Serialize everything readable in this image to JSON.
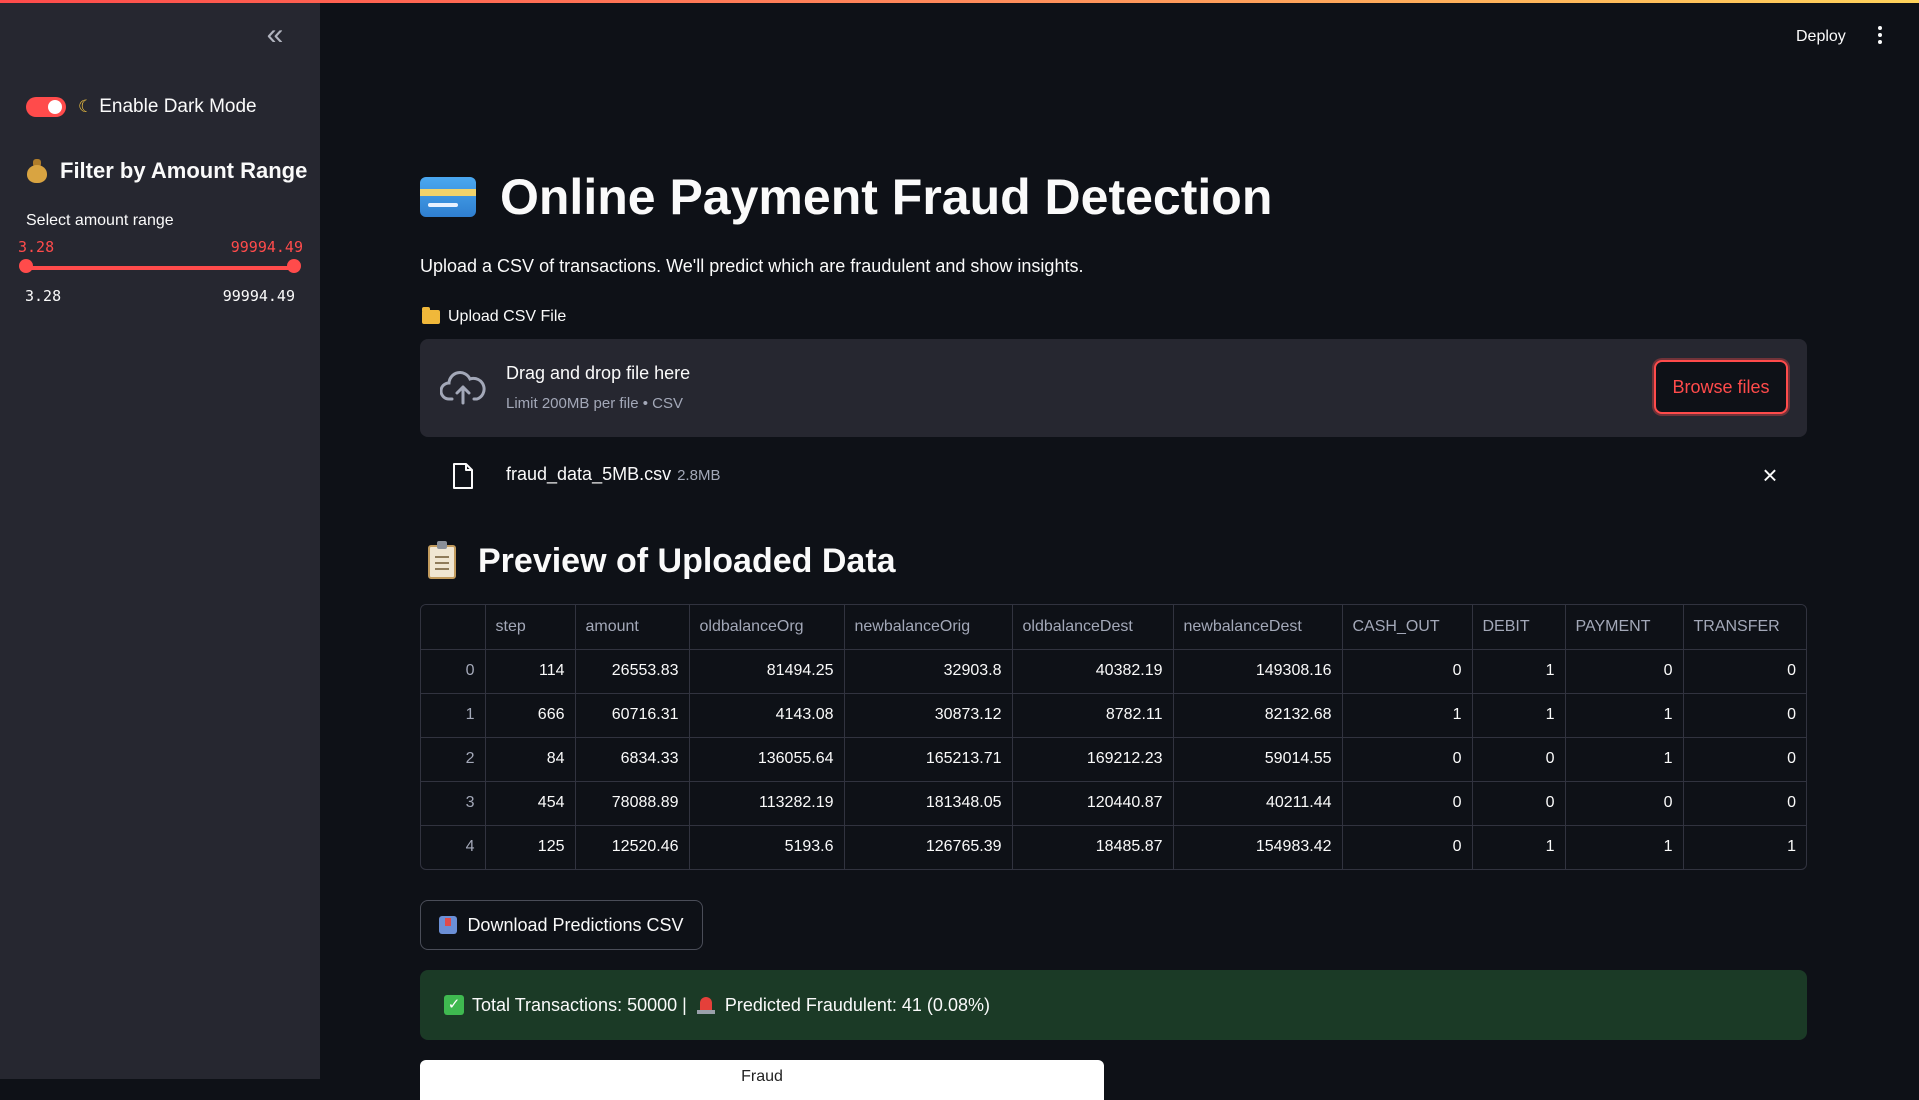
{
  "sidebar": {
    "collapse_glyph": "«",
    "dark_mode_label": "Enable Dark Mode",
    "filter_heading": "Filter by Amount Range",
    "range_label": "Select amount range",
    "range_min": "3.28",
    "range_max": "99994.49",
    "range_lo_value": "3.28",
    "range_hi_value": "99994.49"
  },
  "header": {
    "deploy_label": "Deploy"
  },
  "main": {
    "title": "Online Payment Fraud Detection",
    "subtitle": "Upload a CSV of transactions. We'll predict which are fraudulent and show insights.",
    "upload_label": "Upload CSV File",
    "dropzone_title": "Drag and drop file here",
    "dropzone_sub": "Limit 200MB per file • CSV",
    "browse_label": "Browse files",
    "file_name": "fraud_data_5MB.csv",
    "file_size": "2.8MB",
    "preview_title": "Preview of Uploaded Data",
    "download_label": "Download Predictions CSV",
    "summary_total": "Total Transactions: 50000 |",
    "summary_fraud": "Predicted Fraudulent: 41 (0.08%)",
    "chart_title": "Fraud"
  },
  "table": {
    "columns": [
      "",
      "step",
      "amount",
      "oldbalanceOrg",
      "newbalanceOrig",
      "oldbalanceDest",
      "newbalanceDest",
      "CASH_OUT",
      "DEBIT",
      "PAYMENT",
      "TRANSFER"
    ],
    "rows": [
      [
        "0",
        "114",
        "26553.83",
        "81494.25",
        "32903.8",
        "40382.19",
        "149308.16",
        "0",
        "1",
        "0",
        "0"
      ],
      [
        "1",
        "666",
        "60716.31",
        "4143.08",
        "30873.12",
        "8782.11",
        "82132.68",
        "1",
        "1",
        "1",
        "0"
      ],
      [
        "2",
        "84",
        "6834.33",
        "136055.64",
        "165213.71",
        "169212.23",
        "59014.55",
        "0",
        "0",
        "1",
        "0"
      ],
      [
        "3",
        "454",
        "78088.89",
        "113282.19",
        "181348.05",
        "120440.87",
        "40211.44",
        "0",
        "0",
        "0",
        "0"
      ],
      [
        "4",
        "125",
        "12520.46",
        "5193.6",
        "126765.39",
        "18485.87",
        "154983.42",
        "0",
        "1",
        "1",
        "1"
      ]
    ]
  },
  "colors": {
    "accent": "#ff4b4b",
    "success_bg": "#1b3a26",
    "sidebar_bg": "#262730",
    "page_bg": "#0e1117"
  },
  "icons": [
    "collapse-icon",
    "moon-icon",
    "money-bag-icon",
    "menu-icon",
    "credit-card-icon",
    "folder-icon",
    "cloud-upload-icon",
    "file-icon",
    "close-icon",
    "clipboard-icon",
    "inbox-icon",
    "check-icon",
    "siren-icon"
  ]
}
